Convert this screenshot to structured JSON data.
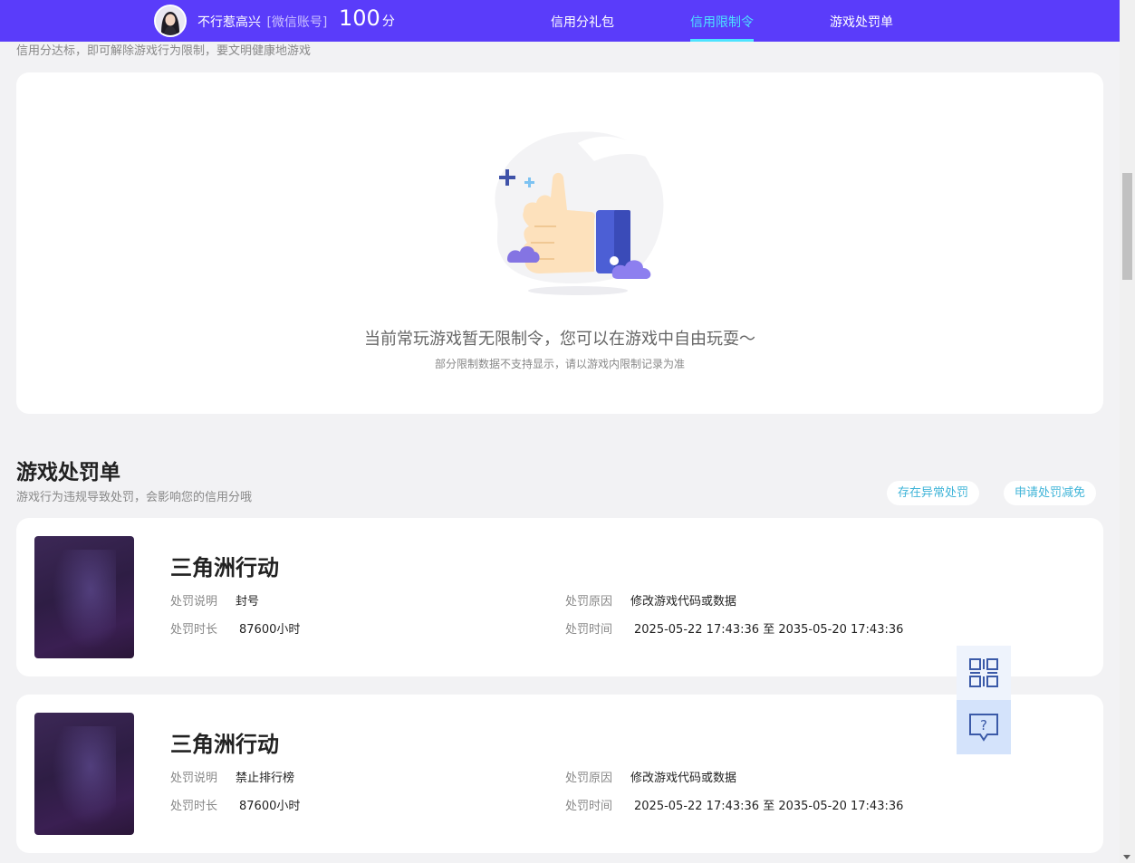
{
  "header": {
    "nickname": "不行惹高兴",
    "account_tag": "[微信账号]",
    "score_value": "100",
    "score_unit": "分",
    "nav": [
      {
        "label": "信用分礼包",
        "active": false
      },
      {
        "label": "信用限制令",
        "active": true
      },
      {
        "label": "游戏处罚单",
        "active": false
      }
    ]
  },
  "restriction": {
    "hint": "信用分达标，即可解除游戏行为限制，要文明健康地游戏",
    "empty_title": "当前常玩游戏暂无限制令，您可以在游戏中自由玩耍～",
    "empty_sub": "部分限制数据不支持显示，请以游戏内限制记录为准"
  },
  "penalties": {
    "title": "游戏处罚单",
    "subtitle": "游戏行为违规导致处罚，会影响您的信用分哦",
    "actions": [
      "存在异常处罚",
      "申请处罚减免"
    ],
    "field_labels": {
      "description": "处罚说明",
      "duration": "处罚时长",
      "reason": "处罚原因",
      "time": "处罚时间"
    },
    "items": [
      {
        "game": "三角洲行动",
        "description": "封号",
        "duration": "87600小时",
        "reason": "修改游戏代码或数据",
        "time": "2025-05-22 17:43:36 至 2035-05-20 17:43:36"
      },
      {
        "game": "三角洲行动",
        "description": "禁止排行榜",
        "duration": "87600小时",
        "reason": "修改游戏代码或数据",
        "time": "2025-05-22 17:43:36 至 2035-05-20 17:43:36"
      }
    ]
  },
  "floating": {
    "qr_icon": "qr-code-icon",
    "help_icon": "help-chat-icon"
  },
  "colors": {
    "brand": "#5a3cfa",
    "nav_active": "#4de3ff",
    "pill_text": "#3fb4d8"
  }
}
